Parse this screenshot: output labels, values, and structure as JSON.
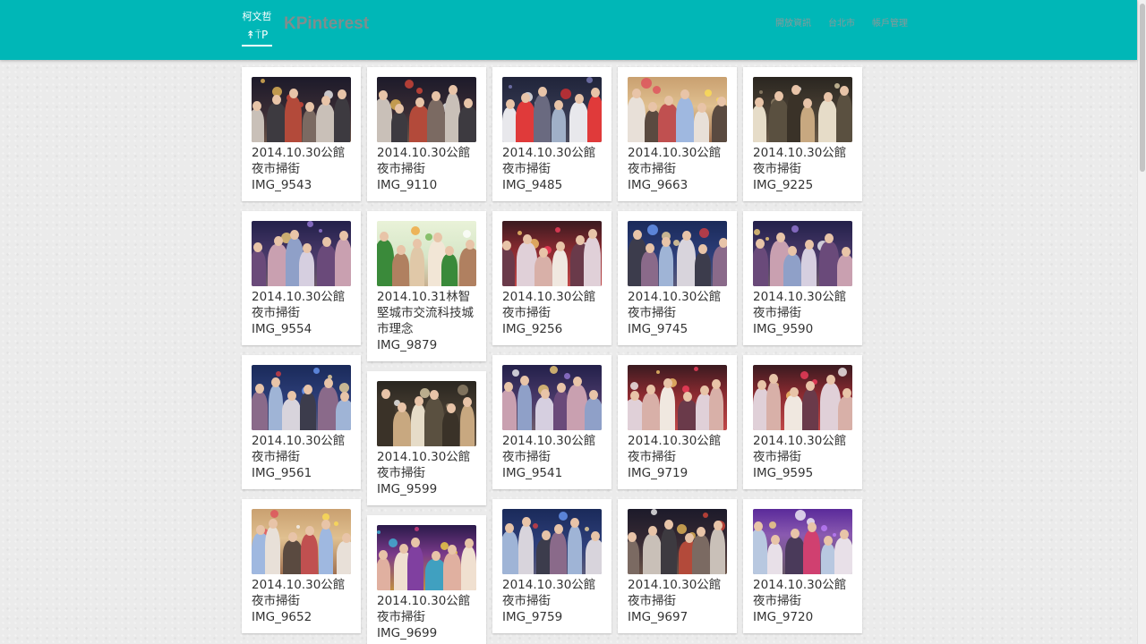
{
  "header": {
    "logo_top": "柯文哲",
    "logo_bottom": "↟⍑P",
    "brand": "KPinterest",
    "nav": [
      "開放資訊",
      "台北市",
      "帳戶管理"
    ]
  },
  "colors": {
    "navbar": "#00b7b7",
    "brand_text": "#7e8e8e",
    "card": "#ffffff",
    "page_bg": "#ebebeb"
  },
  "columns": [
    [
      {
        "caption": "2014.10.30公館夜市掃街",
        "id": "IMG_9543",
        "tone": "night"
      },
      {
        "caption": "2014.10.30公館夜市掃街",
        "id": "IMG_9554",
        "tone": "purple"
      },
      {
        "caption": "2014.10.30公館夜市掃街",
        "id": "IMG_9561",
        "tone": "blue"
      },
      {
        "caption": "2014.10.30公館夜市掃街",
        "id": "IMG_9652",
        "tone": "warm"
      }
    ],
    [
      {
        "caption": "2014.10.30公館夜市掃街",
        "id": "IMG_9110",
        "tone": "night"
      },
      {
        "caption": "2014.10.31林智堅城市交流科技城市理念",
        "id": "IMG_9879",
        "tone": "bright"
      },
      {
        "caption": "2014.10.30公館夜市掃街",
        "id": "IMG_9599",
        "tone": "dark"
      },
      {
        "caption": "2014.10.30公館夜市掃街",
        "id": "IMG_9699",
        "tone": "colorful"
      }
    ],
    [
      {
        "caption": "2014.10.30公館夜市掃街",
        "id": "IMG_9485",
        "tone": "redshirt"
      },
      {
        "caption": "2014.10.30公館夜市掃街",
        "id": "IMG_9256",
        "tone": "red"
      },
      {
        "caption": "2014.10.30公館夜市掃街",
        "id": "IMG_9541",
        "tone": "purple"
      },
      {
        "caption": "2014.10.30公館夜市掃街",
        "id": "IMG_9759",
        "tone": "blue"
      }
    ],
    [
      {
        "caption": "2014.10.30公館夜市掃街",
        "id": "IMG_9663",
        "tone": "warm"
      },
      {
        "caption": "2014.10.30公館夜市掃街",
        "id": "IMG_9745",
        "tone": "blue"
      },
      {
        "caption": "2014.10.30公館夜市掃街",
        "id": "IMG_9719",
        "tone": "red"
      },
      {
        "caption": "2014.10.30公館夜市掃街",
        "id": "IMG_9697",
        "tone": "night"
      }
    ],
    [
      {
        "caption": "2014.10.30公館夜市掃街",
        "id": "IMG_9225",
        "tone": "dark"
      },
      {
        "caption": "2014.10.30公館夜市掃街",
        "id": "IMG_9590",
        "tone": "purple"
      },
      {
        "caption": "2014.10.30公館夜市掃街",
        "id": "IMG_9595",
        "tone": "red"
      },
      {
        "caption": "2014.10.30公館夜市掃街",
        "id": "IMG_9720",
        "tone": "violet"
      }
    ]
  ]
}
